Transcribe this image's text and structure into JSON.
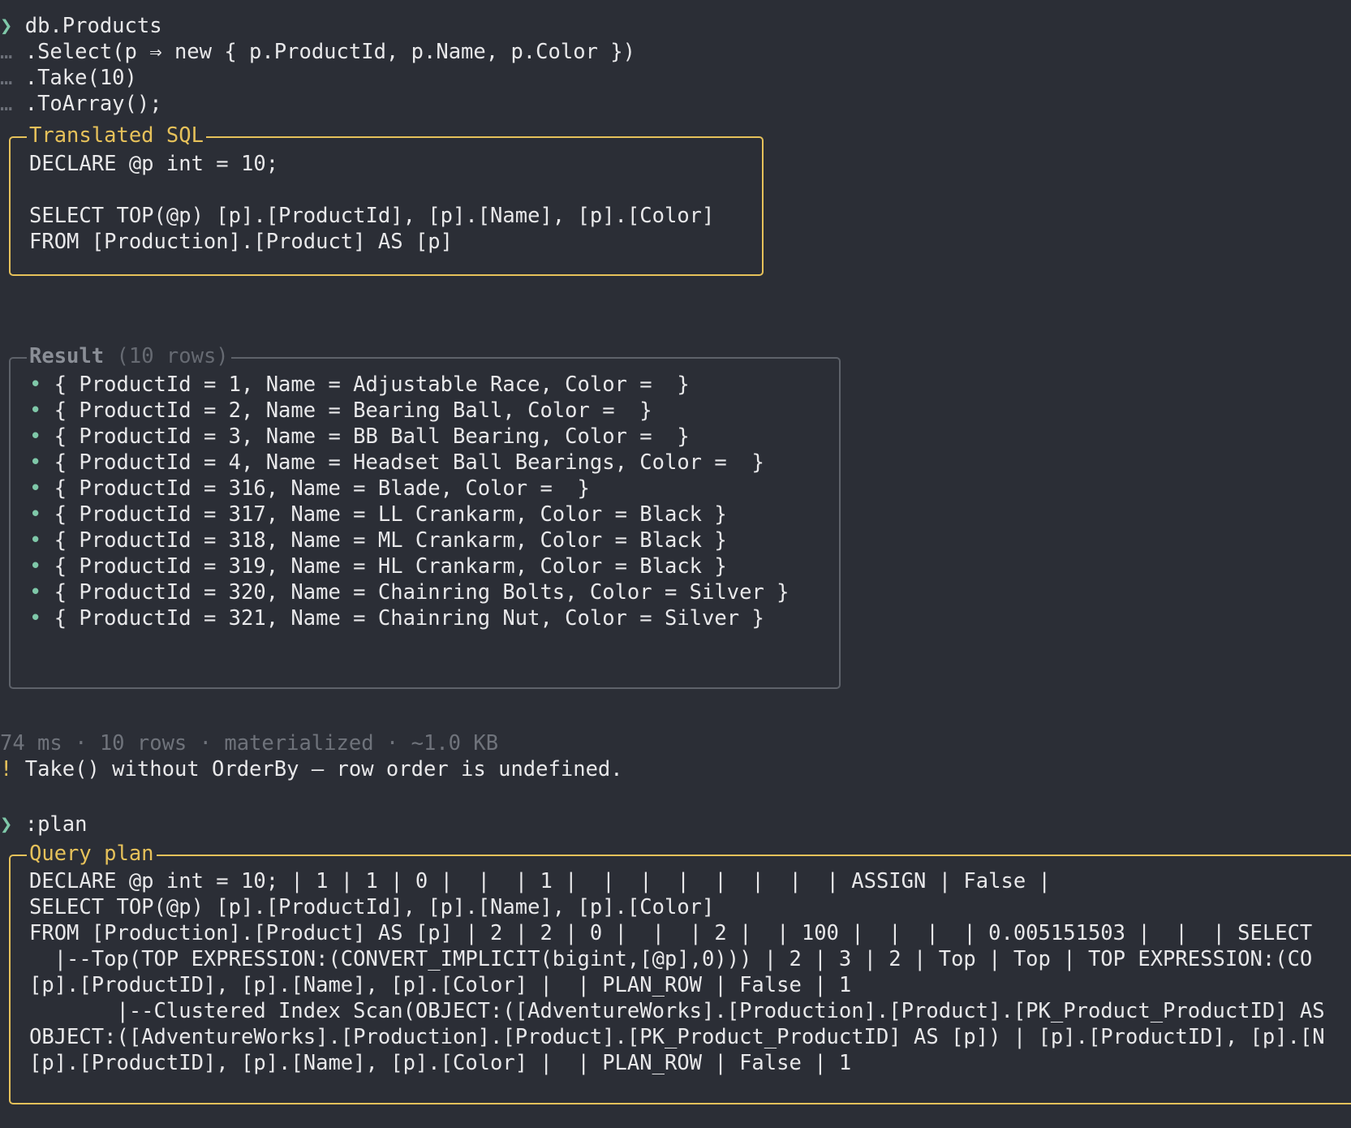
{
  "query": {
    "prompt_symbol": "❯",
    "continuation_symbol": "…",
    "lines": [
      "db.Products",
      ".Select(p ⇒ new { p.ProductId, p.Name, p.Color })",
      ".Take(10)",
      ".ToArray();"
    ]
  },
  "translated_sql": {
    "title": "Translated SQL",
    "lines": [
      "DECLARE @p int = 10;",
      "",
      "SELECT TOP(@p) [p].[ProductId], [p].[Name], [p].[Color]",
      "FROM [Production].[Product] AS [p]"
    ]
  },
  "result": {
    "title": "Result",
    "subtitle": "(10 rows)",
    "bullet": "•",
    "rows": [
      "{ ProductId = 1, Name = Adjustable Race, Color =  }",
      "{ ProductId = 2, Name = Bearing Ball, Color =  }",
      "{ ProductId = 3, Name = BB Ball Bearing, Color =  }",
      "{ ProductId = 4, Name = Headset Ball Bearings, Color =  }",
      "{ ProductId = 316, Name = Blade, Color =  }",
      "{ ProductId = 317, Name = LL Crankarm, Color = Black }",
      "{ ProductId = 318, Name = ML Crankarm, Color = Black }",
      "{ ProductId = 319, Name = HL Crankarm, Color = Black }",
      "{ ProductId = 320, Name = Chainring Bolts, Color = Silver }",
      "{ ProductId = 321, Name = Chainring Nut, Color = Silver }"
    ]
  },
  "stats": "74 ms · 10 rows · materialized · ~1.0 KB",
  "warning": {
    "symbol": "!",
    "text": "Take() without OrderBy — row order is undefined."
  },
  "command": ":plan",
  "query_plan": {
    "title": "Query plan",
    "lines": [
      "DECLARE @p int = 10; | 1 | 1 | 0 |  |  | 1 |  |  |  |  |  |  |  | ASSIGN | False |",
      "SELECT TOP(@p) [p].[ProductId], [p].[Name], [p].[Color]",
      "FROM [Production].[Product] AS [p] | 2 | 2 | 0 |  |  | 2 |  | 100 |  |  |  | 0.005151503 |  |  | SELECT",
      "  |--Top(TOP EXPRESSION:(CONVERT_IMPLICIT(bigint,[@p],0))) | 2 | 3 | 2 | Top | Top | TOP EXPRESSION:(CO",
      "[p].[ProductID], [p].[Name], [p].[Color] |  | PLAN_ROW | False | 1",
      "       |--Clustered Index Scan(OBJECT:([AdventureWorks].[Production].[Product].[PK_Product_ProductID] AS",
      "OBJECT:([AdventureWorks].[Production].[Product].[PK_Product_ProductID] AS [p]) | [p].[ProductID], [p].[N",
      "[p].[ProductID], [p].[Name], [p].[Color] |  | PLAN_ROW | False | 1"
    ]
  }
}
